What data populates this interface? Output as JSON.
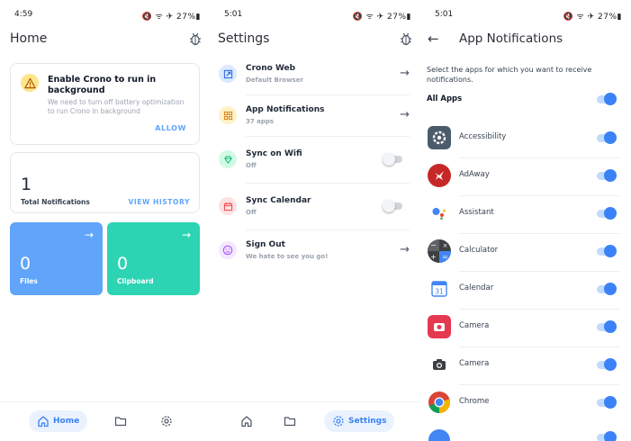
{
  "screen1": {
    "status": {
      "time": "4:59",
      "icons": "🔇 ᯤ ✈ 27%▮"
    },
    "title": "Home",
    "warning": {
      "title": "Enable Crono to run in background",
      "description": "We need to turn off battery optimization to run Crono in background",
      "action": "ALLOW"
    },
    "notifications": {
      "count": "1",
      "label": "Total Notifications",
      "action": "VIEW HISTORY"
    },
    "tiles": [
      {
        "count": "0",
        "label": "Files",
        "color": "#60a5fa"
      },
      {
        "count": "0",
        "label": "Clipboard",
        "color": "#2dd4b3"
      }
    ],
    "nav": {
      "home_label": "Home"
    }
  },
  "screen2": {
    "status": {
      "time": "5:01",
      "icons": "🔇 ᯤ ✈ 27%▮"
    },
    "title": "Settings",
    "items": [
      {
        "title": "Crono Web",
        "subtitle": "Default Browser",
        "icon": "open-external-icon",
        "control": "arrow"
      },
      {
        "title": "App Notifications",
        "subtitle": "37 apps",
        "icon": "grid-icon",
        "control": "arrow"
      },
      {
        "title": "Sync on Wifi",
        "subtitle": "Off",
        "icon": "diamond-icon",
        "control": "toggle-off"
      },
      {
        "title": "Sync Calendar",
        "subtitle": "Off",
        "icon": "calendar-icon",
        "control": "toggle-off"
      },
      {
        "title": "Sign Out",
        "subtitle": "We hate to see you go!",
        "icon": "sad-face-icon",
        "control": "arrow"
      }
    ],
    "nav": {
      "settings_label": "Settings"
    }
  },
  "screen3": {
    "status": {
      "time": "5:01",
      "icons": "🔇 ᯤ ✈ 27%▮"
    },
    "title": "App Notifications",
    "intro": "Select the apps for which you want to receive notifications.",
    "all_apps_label": "All Apps",
    "apps": [
      {
        "name": "Accessibility",
        "icon": "accessibility-icon",
        "enabled": true
      },
      {
        "name": "AdAway",
        "icon": "adaway-icon",
        "enabled": true
      },
      {
        "name": "Assistant",
        "icon": "assistant-icon",
        "enabled": true
      },
      {
        "name": "Calculator",
        "icon": "calculator-icon",
        "enabled": true
      },
      {
        "name": "Calendar",
        "icon": "calendar-app-icon",
        "enabled": true
      },
      {
        "name": "Camera",
        "icon": "camera-red-icon",
        "enabled": true
      },
      {
        "name": "Camera",
        "icon": "camera-dark-icon",
        "enabled": true
      },
      {
        "name": "Chrome",
        "icon": "chrome-icon",
        "enabled": true
      }
    ],
    "calendar_day": "31"
  }
}
